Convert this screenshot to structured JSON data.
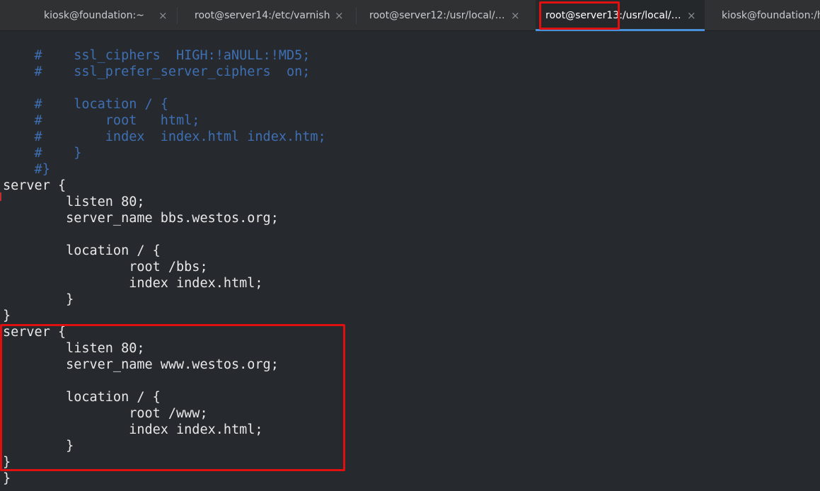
{
  "tabs": [
    {
      "label": "kiosk@foundation:~",
      "close": "×",
      "active": false
    },
    {
      "label": "root@server14:/etc/varnish",
      "close": "×",
      "active": false
    },
    {
      "label": "root@server12:/usr/local/…",
      "close": "×",
      "active": false
    },
    {
      "label": "root@server13:/usr/local/…",
      "close": "×",
      "active": true
    },
    {
      "label": "kiosk@foundation:/h",
      "close": "",
      "active": false
    }
  ],
  "terminal": {
    "lines": [
      {
        "text": "    #    ssl_ciphers  HIGH:!aNULL:!MD5;",
        "kind": "comment"
      },
      {
        "text": "    #    ssl_prefer_server_ciphers  on;",
        "kind": "comment"
      },
      {
        "text": "",
        "kind": "plain"
      },
      {
        "text": "    #    location / {",
        "kind": "comment"
      },
      {
        "text": "    #        root   html;",
        "kind": "comment"
      },
      {
        "text": "    #        index  index.html index.htm;",
        "kind": "comment"
      },
      {
        "text": "    #    }",
        "kind": "comment"
      },
      {
        "text": "    #}",
        "kind": "comment"
      },
      {
        "text": "server {",
        "kind": "plain"
      },
      {
        "text": "        listen 80;",
        "kind": "plain"
      },
      {
        "text": "        server_name bbs.westos.org;",
        "kind": "plain"
      },
      {
        "text": "",
        "kind": "plain"
      },
      {
        "text": "        location / {",
        "kind": "plain"
      },
      {
        "text": "                root /bbs;",
        "kind": "plain"
      },
      {
        "text": "                index index.html;",
        "kind": "plain"
      },
      {
        "text": "        }",
        "kind": "plain"
      },
      {
        "text": "}",
        "kind": "plain"
      },
      {
        "text": "server {",
        "kind": "plain"
      },
      {
        "text": "        listen 80;",
        "kind": "plain"
      },
      {
        "text": "        server_name www.westos.org;",
        "kind": "plain"
      },
      {
        "text": "",
        "kind": "plain"
      },
      {
        "text": "        location / {",
        "kind": "plain"
      },
      {
        "text": "                root /www;",
        "kind": "plain"
      },
      {
        "text": "                index index.html;",
        "kind": "plain"
      },
      {
        "text": "        }",
        "kind": "plain"
      },
      {
        "text": "}",
        "kind": "plain"
      },
      {
        "text": "}",
        "kind": "plain"
      }
    ]
  },
  "colors": {
    "comment": "#3f6fb3",
    "text": "#e8e8e8",
    "background": "#262a2e",
    "annotation": "#e01010",
    "active_tab_underline": "#4a90d9"
  }
}
